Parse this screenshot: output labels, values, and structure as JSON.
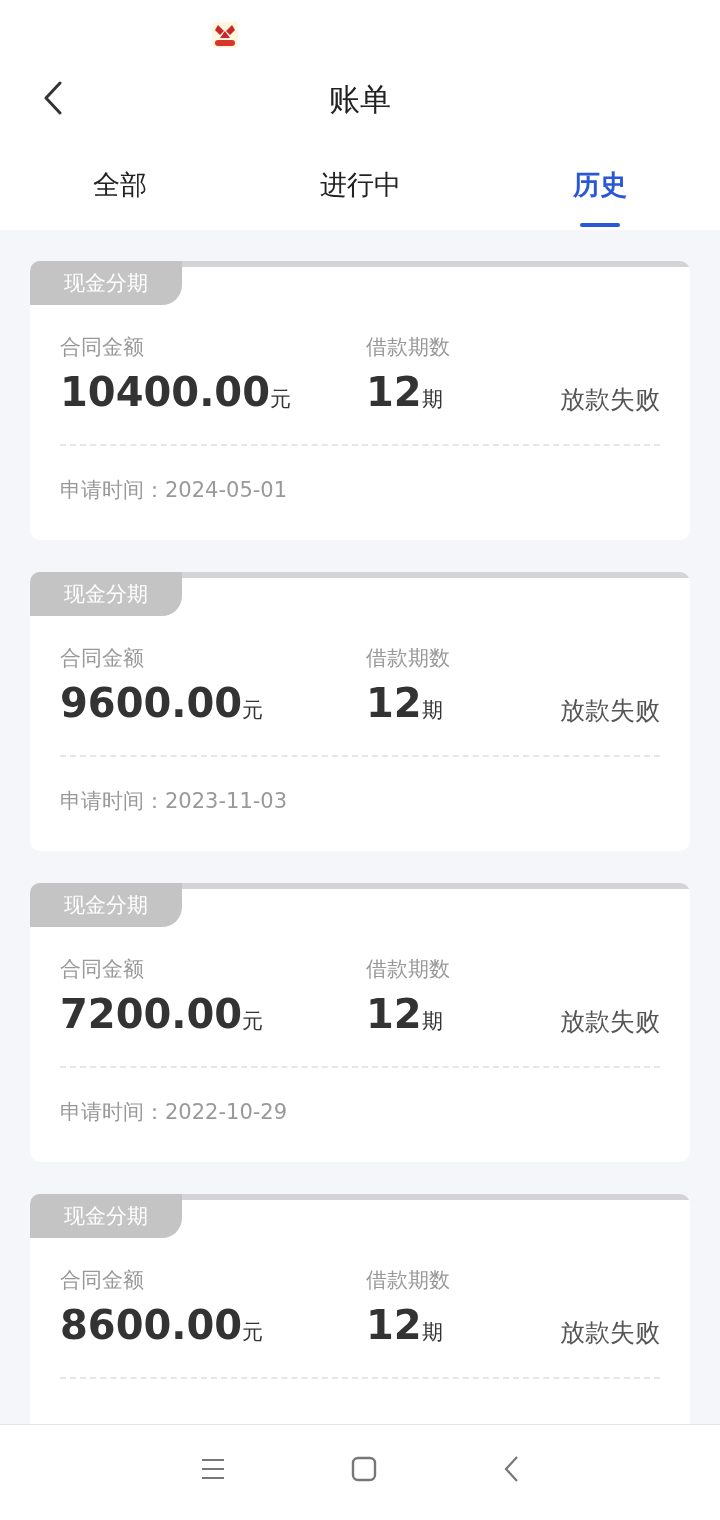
{
  "header": {
    "title": "账单"
  },
  "tabs": [
    {
      "label": "全部",
      "selected": false
    },
    {
      "label": "进行中",
      "selected": false
    },
    {
      "label": "历史",
      "selected": true
    }
  ],
  "bills": [
    {
      "tag": "现金分期",
      "amount_label": "合同金额",
      "amount": "10400.00",
      "amount_unit": "元",
      "term_label": "借款期数",
      "term": "12",
      "term_unit": "期",
      "status": "放款失败",
      "date": "申请时间：2024-05-01"
    },
    {
      "tag": "现金分期",
      "amount_label": "合同金额",
      "amount": "9600.00",
      "amount_unit": "元",
      "term_label": "借款期数",
      "term": "12",
      "term_unit": "期",
      "status": "放款失败",
      "date": "申请时间：2023-11-03"
    },
    {
      "tag": "现金分期",
      "amount_label": "合同金额",
      "amount": "7200.00",
      "amount_unit": "元",
      "term_label": "借款期数",
      "term": "12",
      "term_unit": "期",
      "status": "放款失败",
      "date": "申请时间：2022-10-29"
    },
    {
      "tag": "现金分期",
      "amount_label": "合同金额",
      "amount": "8600.00",
      "amount_unit": "元",
      "term_label": "借款期数",
      "term": "12",
      "term_unit": "期",
      "status": "放款失败"
    }
  ]
}
